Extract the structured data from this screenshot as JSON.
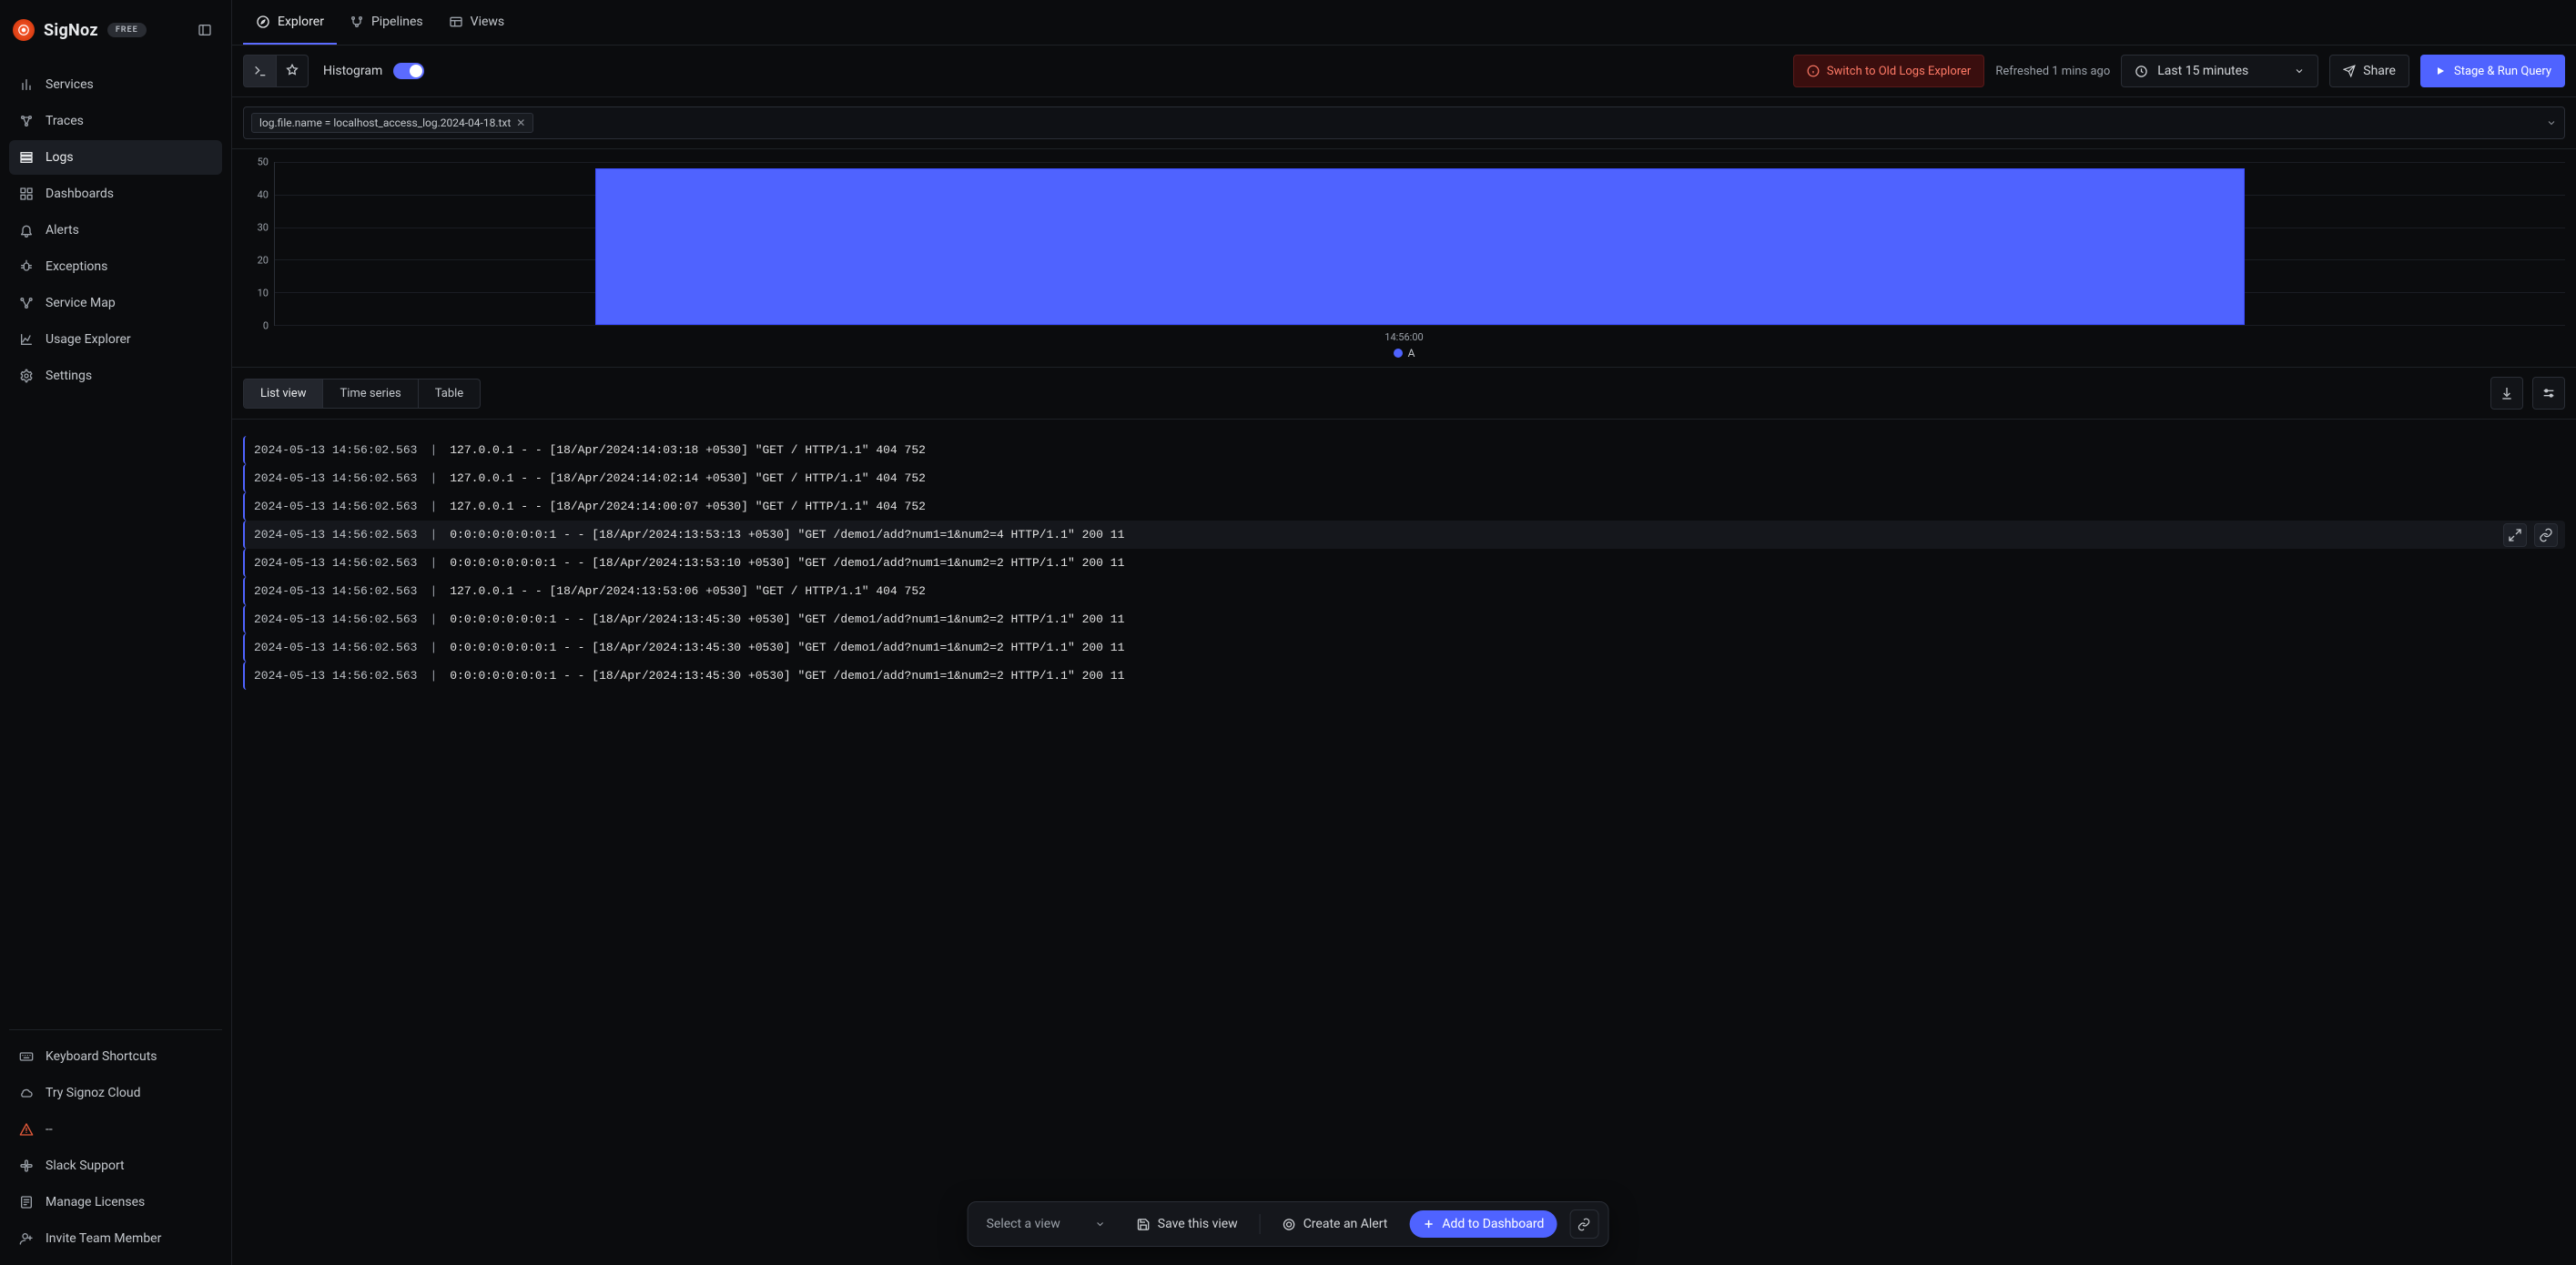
{
  "brand": {
    "name": "SigNoz",
    "plan": "FREE"
  },
  "sidebar": {
    "items": [
      {
        "label": "Services",
        "icon": "bar-chart-icon"
      },
      {
        "label": "Traces",
        "icon": "network-icon"
      },
      {
        "label": "Logs",
        "icon": "logs-icon",
        "active": true
      },
      {
        "label": "Dashboards",
        "icon": "grid-icon"
      },
      {
        "label": "Alerts",
        "icon": "bell-icon"
      },
      {
        "label": "Exceptions",
        "icon": "bug-icon"
      },
      {
        "label": "Service Map",
        "icon": "map-icon"
      },
      {
        "label": "Usage Explorer",
        "icon": "usage-icon"
      },
      {
        "label": "Settings",
        "icon": "gear-icon"
      }
    ],
    "bottom": [
      {
        "label": "Keyboard Shortcuts",
        "icon": "keyboard-icon"
      },
      {
        "label": "Try Signoz Cloud",
        "icon": "cloud-icon"
      },
      {
        "label": "--",
        "icon": "warning-icon",
        "warn": true
      },
      {
        "label": "Slack Support",
        "icon": "slack-icon"
      },
      {
        "label": "Manage Licenses",
        "icon": "license-icon"
      },
      {
        "label": "Invite Team Member",
        "icon": "invite-icon"
      }
    ]
  },
  "topnav": {
    "tabs": [
      {
        "label": "Explorer",
        "icon": "compass-icon",
        "active": true
      },
      {
        "label": "Pipelines",
        "icon": "pipelines-icon"
      },
      {
        "label": "Views",
        "icon": "views-icon"
      }
    ]
  },
  "toolbar": {
    "mode_label": "Histogram",
    "switch_label": "Switch to Old Logs Explorer",
    "refreshed": "Refreshed 1 mins ago",
    "timerange": "Last 15 minutes",
    "share": "Share",
    "run": "Stage & Run Query"
  },
  "query": {
    "chips": [
      "log.file.name = localhost_access_log.2024-04-18.txt"
    ]
  },
  "chart_data": {
    "type": "bar",
    "categories": [
      "14:56:00"
    ],
    "series": [
      {
        "name": "A",
        "values": [
          48
        ]
      }
    ],
    "ylim": [
      0,
      50
    ],
    "yticks": [
      0,
      10,
      20,
      30,
      40,
      50
    ],
    "xlabel": "",
    "ylabel": "",
    "title": "",
    "legend": [
      "A"
    ],
    "bar_span_fraction": [
      0.14,
      0.86
    ]
  },
  "viewtabs": {
    "items": [
      {
        "label": "List view",
        "active": true
      },
      {
        "label": "Time series"
      },
      {
        "label": "Table"
      }
    ]
  },
  "logs": {
    "timestamp_column": "2024-05-13 14:56:02.563",
    "rows": [
      {
        "ts": "2024-05-13 14:56:02.563",
        "body": "127.0.0.1 - - [18/Apr/2024:14:03:18 +0530] \"GET / HTTP/1.1\" 404 752"
      },
      {
        "ts": "2024-05-13 14:56:02.563",
        "body": "127.0.0.1 - - [18/Apr/2024:14:02:14 +0530] \"GET / HTTP/1.1\" 404 752"
      },
      {
        "ts": "2024-05-13 14:56:02.563",
        "body": "127.0.0.1 - - [18/Apr/2024:14:00:07 +0530] \"GET / HTTP/1.1\" 404 752"
      },
      {
        "ts": "2024-05-13 14:56:02.563",
        "body": "0:0:0:0:0:0:0:1 - - [18/Apr/2024:13:53:13 +0530] \"GET /demo1/add?num1=1&num2=4 HTTP/1.1\" 200 11",
        "hover": true
      },
      {
        "ts": "2024-05-13 14:56:02.563",
        "body": "0:0:0:0:0:0:0:1 - - [18/Apr/2024:13:53:10 +0530] \"GET /demo1/add?num1=1&num2=2 HTTP/1.1\" 200 11"
      },
      {
        "ts": "2024-05-13 14:56:02.563",
        "body": "127.0.0.1 - - [18/Apr/2024:13:53:06 +0530] \"GET / HTTP/1.1\" 404 752"
      },
      {
        "ts": "2024-05-13 14:56:02.563",
        "body": "0:0:0:0:0:0:0:1 - - [18/Apr/2024:13:45:30 +0530] \"GET /demo1/add?num1=1&num2=2 HTTP/1.1\" 200 11"
      },
      {
        "ts": "2024-05-13 14:56:02.563",
        "body": "0:0:0:0:0:0:0:1 - - [18/Apr/2024:13:45:30 +0530] \"GET /demo1/add?num1=1&num2=2 HTTP/1.1\" 200 11"
      },
      {
        "ts": "2024-05-13 14:56:02.563",
        "body": "0:0:0:0:0:0:0:1 - - [18/Apr/2024:13:45:30 +0530] \"GET /demo1/add?num1=1&num2=2 HTTP/1.1\" 200 11"
      }
    ]
  },
  "floatbar": {
    "select_placeholder": "Select a view",
    "save": "Save this view",
    "alert": "Create an Alert",
    "dashboard": "Add to Dashboard"
  }
}
